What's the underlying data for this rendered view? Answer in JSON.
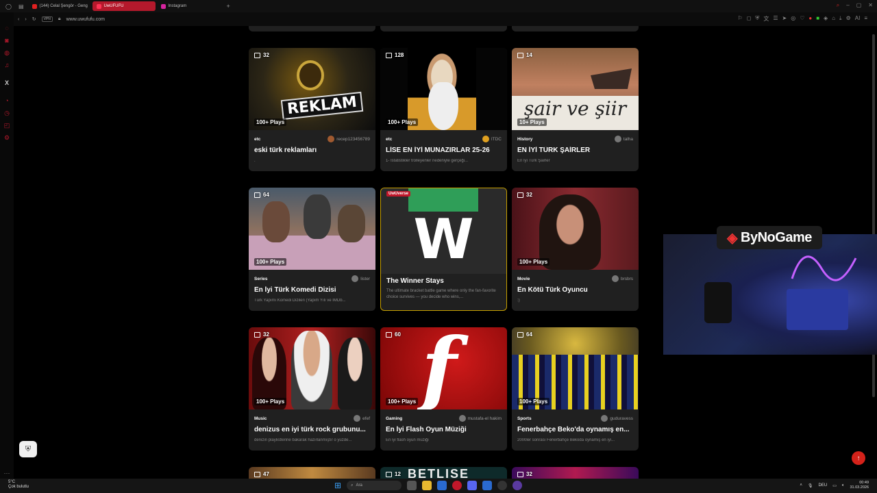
{
  "browser": {
    "tabs": [
      {
        "label": "(144) Celal Şengör - Geng",
        "color": "#e02020",
        "active": false
      },
      {
        "label": "UwUFUFU",
        "color": "#ff3355",
        "active": true
      },
      {
        "label": "Instagram",
        "color": "#d6249f",
        "active": false
      }
    ],
    "new_tab": "+",
    "address": {
      "vpn": "VPN",
      "url": "www.uwufufu.com"
    },
    "ai_label": "AI"
  },
  "sidebar_icons": [
    "messenger-icon",
    "instagram-icon",
    "whatsapp-icon",
    "music-icon",
    "x-icon",
    "history-icon",
    "clock-icon",
    "settings-icon",
    "more-icon"
  ],
  "cards": [
    {
      "count": "32",
      "plays": "100+ Plays",
      "category": "etc",
      "author": "recep123456789",
      "title": "eski türk reklamları",
      "desc": ".",
      "image": "reklam",
      "image_text": "REKLAM"
    },
    {
      "count": "128",
      "plays": "100+ Plays",
      "category": "etc",
      "author": "ITDC",
      "title": "LİSE EN İYİ MÜNAZIRLAR 25-26",
      "desc": "1- İstatistikler trolleyenler nedeniyle gerçeği...",
      "image": "sage",
      "image_text": ""
    },
    {
      "count": "14",
      "plays": "10+ Plays",
      "category": "History",
      "author": "talha",
      "title": "EN İYİ TÜRK ŞAİRLER",
      "desc": "En İyi Türk Şairler",
      "image": "sair",
      "image_text": "şair ve şiir"
    },
    {
      "count": "64",
      "plays": "100+ Plays",
      "category": "Series",
      "author": "lister",
      "title": "En İyi Türk Komedi Dizisi",
      "desc": "Türk Yapımı Komedi Dizileri (Yapım Yılı ve IMDb...",
      "image": "dinner",
      "image_text": ""
    },
    {
      "count": "",
      "plays": "",
      "category": "",
      "author": "",
      "title": "The Winner Stays",
      "desc": "The ultimate bracket battle game where only the fan-favorite choice survives — you decide who wins,...",
      "image": "winner",
      "image_text": "W",
      "badge": "UwUverse"
    },
    {
      "count": "32",
      "plays": "100+ Plays",
      "category": "Movie",
      "author": "brsbrs",
      "title": "En Kötü Türk Oyuncu",
      "desc": ":)",
      "image": "actor",
      "image_text": ""
    },
    {
      "count": "32",
      "plays": "100+ Plays",
      "category": "Music",
      "author": "efef",
      "title": "denizus en iyi türk rock grubunu...",
      "desc": "denizin playlistlerine bakarak hazırlanmıştır o yüzde...",
      "image": "rock",
      "image_text": ""
    },
    {
      "count": "60",
      "plays": "100+ Plays",
      "category": "Gaming",
      "author": "mustafa-el hakim",
      "title": "En İyi Flash Oyun Müziği",
      "desc": "En iyi flash oyun müziği",
      "image": "flash",
      "image_text": ""
    },
    {
      "count": "64",
      "plays": "100+ Plays",
      "category": "Sports",
      "author": "guduravess",
      "title": "Fenerbahçe Beko'da oynamış en...",
      "desc": "2000ler sonrası Fenerbahçe Bekoda oynamış en iyi...",
      "image": "fener",
      "image_text": ""
    }
  ],
  "partial_cards": [
    {
      "count": "47"
    },
    {
      "count": "12",
      "text": "BETLISE"
    },
    {
      "count": "32"
    }
  ],
  "promo": {
    "brand": "ByNoGame"
  },
  "taskbar": {
    "weather_temp": "5°C",
    "weather_text": "Çok bulutlu",
    "search_placeholder": "Ara",
    "language": "DEU",
    "time": "00:49",
    "date": "31.03.2026"
  },
  "colors": {
    "accent": "#b5192c",
    "card_bg": "#202020",
    "highlight_border": "#c8a100",
    "to_top_button": "#d4221a"
  }
}
